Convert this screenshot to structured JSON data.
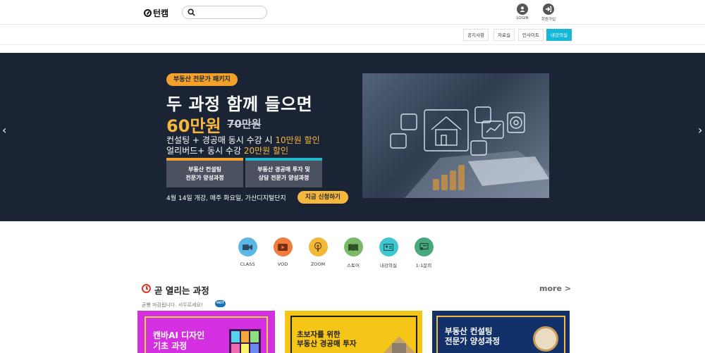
{
  "header": {
    "logo_text": "턴캠",
    "search_placeholder": "",
    "login_label": "LOGIN",
    "signup_label": "회원가입"
  },
  "nav": {
    "items": [
      "공지사항",
      "자료실",
      "인사이트",
      "내강의실"
    ],
    "active_index": 3
  },
  "hero": {
    "badge": "부동산 전문가 패키지",
    "headline": "두 과정 함께 들으면",
    "price": "60만원",
    "price_old": "70만원",
    "line1_prefix": "컨설팅 + 경공매 동시 수강 시 ",
    "line1_highlight": "10만원 할인",
    "line2_prefix": "얼리버드+ 동시 수강 ",
    "line2_highlight": "20만원 할인",
    "card1": "부동산 컨설팅\n전문가 양성과정",
    "card2": "부동산 경공매 투자 및\n상담 전문가 양성과정",
    "note": "4월 14일 개강, 매주 화요일, 가산디지털단지",
    "cta": "지금 신청하기"
  },
  "quick_menu": [
    {
      "label": "CLASS",
      "icon": "video-camera-icon",
      "color": "#5bb8e6"
    },
    {
      "label": "VOD",
      "icon": "play-icon",
      "color": "#f07d3f"
    },
    {
      "label": "ZOOM",
      "icon": "podcast-icon",
      "color": "#f2b838"
    },
    {
      "label": "스토어",
      "icon": "book-icon",
      "color": "#7cb86a"
    },
    {
      "label": "내강의실",
      "icon": "id-card-icon",
      "color": "#3fc6cf"
    },
    {
      "label": "1:1문의",
      "icon": "chat-icon",
      "color": "#48a97d"
    }
  ],
  "section": {
    "title": "곧 열리는 과정",
    "more": "more >",
    "subtitle": "곧빵 마감됩니다. 서두르세요!",
    "hot": "HOT"
  },
  "courses": [
    {
      "title": "캔바AI 디자인\n기초 과정",
      "color": "#d42fe0"
    },
    {
      "title": "초보자를 위한\n부동산 경공매 투자",
      "color": "#f5c518"
    },
    {
      "title": "부동산 컨설팅\n전문가 양성과정",
      "color": "#12306a"
    }
  ]
}
